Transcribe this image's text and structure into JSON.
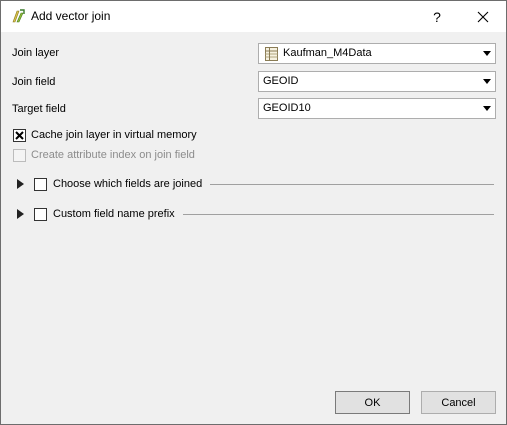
{
  "window": {
    "title": "Add vector join",
    "help_glyph": "?",
    "close_glyph": "✕"
  },
  "form": {
    "join_layer": {
      "label": "Join layer",
      "value": "Kaufman_M4Data",
      "icon": "vector-table-layer-icon"
    },
    "join_field": {
      "label": "Join field",
      "value": "GEOID"
    },
    "target_field": {
      "label": "Target field",
      "value": "GEOID10"
    }
  },
  "options": {
    "cache": {
      "label": "Cache join layer in virtual memory",
      "checked": true
    },
    "index": {
      "label": "Create attribute index on join field",
      "checked": false,
      "enabled": false
    }
  },
  "groups": [
    {
      "label": "Choose which fields are joined",
      "checked": false,
      "expanded": false
    },
    {
      "label": "Custom field name prefix",
      "checked": false,
      "expanded": false
    }
  ],
  "buttons": {
    "ok": "OK",
    "cancel": "Cancel"
  }
}
